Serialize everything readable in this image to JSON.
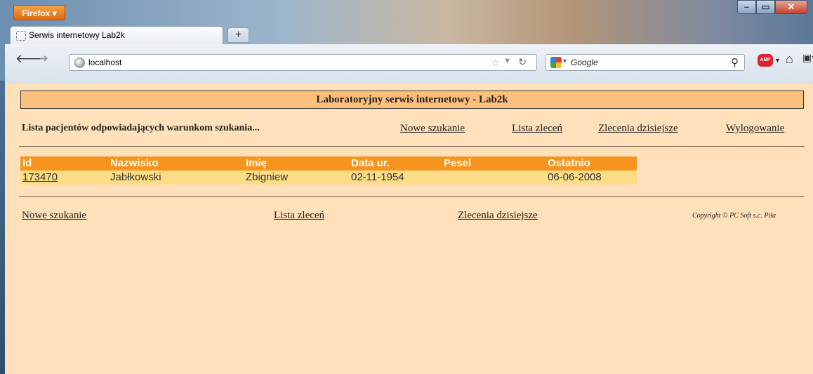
{
  "browser": {
    "app_button": "Firefox ▾",
    "window_controls": [
      "–",
      "▭",
      "✕"
    ],
    "tab": {
      "title": "Serwis internetowy Lab2k"
    },
    "new_tab": "+",
    "url": "localhost",
    "search": {
      "engine": "Google",
      "placeholder": "Google"
    },
    "addon_badge": "ABP"
  },
  "page": {
    "header": "Laboratoryjny serwis internetowy - Lab2k",
    "subtitle": "Lista pacjentów odpowiadających warunkom szukania...",
    "top_links": [
      "Nowe szukanie",
      "Lista zleceń",
      "Zlecenia dzisiejsze",
      "Wylogowanie"
    ],
    "table": {
      "columns": [
        "Id",
        "Nazwisko",
        "Imię",
        "Data ur.",
        "Pesel",
        "Ostatnio"
      ],
      "rows": [
        [
          "173470",
          "Jabłkowski",
          "Zbigniew",
          "02-11-1954",
          "",
          "06-06-2008"
        ]
      ]
    },
    "bottom_links": [
      "Nowe szukanie",
      "Lista zleceń",
      "Zlecenia dzisiejsze"
    ],
    "copyright": "Copyright © PC Soft s.c. Piła"
  },
  "colors": {
    "page_bg": "#fee0ba",
    "header_bg": "#fdbf7c",
    "table_head_bg": "#f7941d",
    "table_row_bg": "#fcdc87",
    "firefox_orange": "#e8791e"
  }
}
